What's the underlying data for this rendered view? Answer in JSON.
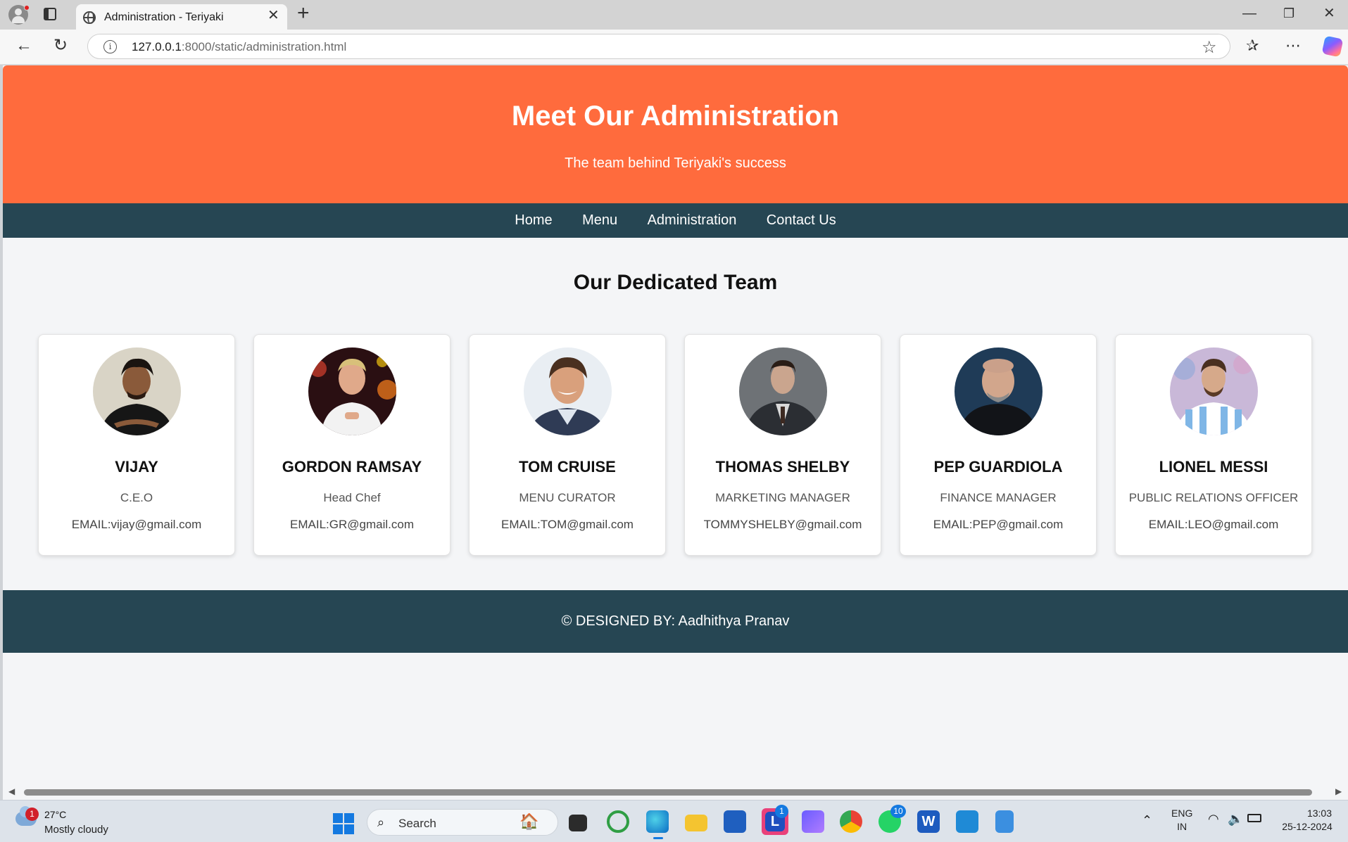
{
  "browser": {
    "tab_title": "Administration - Teriyaki",
    "url_host": "127.0.0.1",
    "url_rest": ":8000/static/administration.html"
  },
  "page": {
    "hero_title": "Meet Our Administration",
    "hero_subtitle": "The team behind Teriyaki's success",
    "nav": [
      "Home",
      "Menu",
      "Administration",
      "Contact Us"
    ],
    "section_title": "Our Dedicated Team",
    "team": [
      {
        "name": "VIJAY",
        "role": "C.E.O",
        "email": "EMAIL:vijay@gmail.com"
      },
      {
        "name": "GORDON RAMSAY",
        "role": "Head Chef",
        "email": "EMAIL:GR@gmail.com"
      },
      {
        "name": "TOM CRUISE",
        "role": "MENU CURATOR",
        "email": "EMAIL:TOM@gmail.com"
      },
      {
        "name": "THOMAS SHELBY",
        "role": "MARKETING MANAGER",
        "email": "TOMMYSHELBY@gmail.com"
      },
      {
        "name": "PEP GUARDIOLA",
        "role": "FINANCE MANAGER",
        "email": "EMAIL:PEP@gmail.com"
      },
      {
        "name": "LIONEL MESSI",
        "role": "PUBLIC RELATIONS OFFICER",
        "email": "EMAIL:LEO@gmail.com"
      }
    ],
    "footer": "© DESIGNED BY: Aadhithya Pranav"
  },
  "taskbar": {
    "weather_badge": "1",
    "temperature": "27°C",
    "condition": "Mostly cloudy",
    "search_label": "Search",
    "lens_badge": "1",
    "whatsapp_badge": "10",
    "language": "ENG",
    "region": "IN",
    "time": "13:03",
    "date": "25-12-2024"
  },
  "colors": {
    "hero": "#ff6b3d",
    "nav": "#264653",
    "page_bg": "#f4f5f7"
  }
}
